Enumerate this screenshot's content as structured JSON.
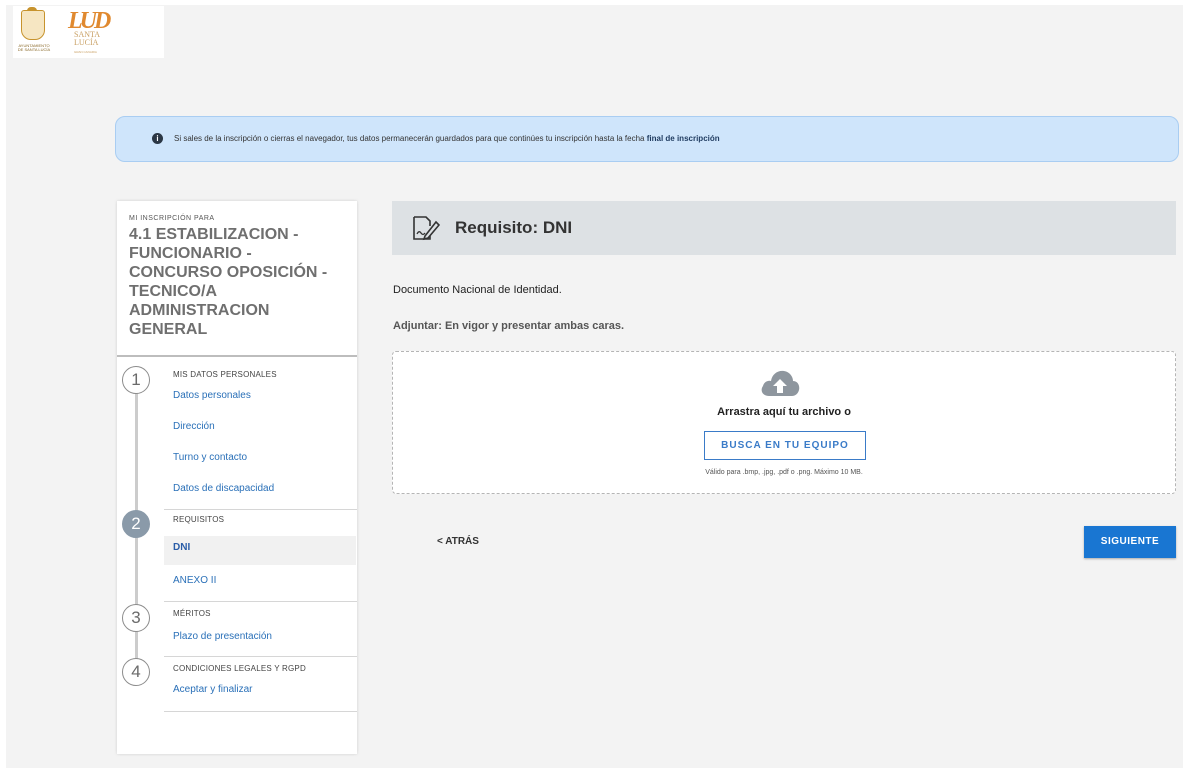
{
  "brand": {
    "crest_text": "AYUNTAMIENTO DE SANTA LUCÍA",
    "mark": "LUD",
    "name": "SANTA LUCÍA",
    "sub": "GRAN CANARIA"
  },
  "notice": {
    "icon": "info-icon",
    "text": "Si sales de la inscripción o cierras el navegador, tus datos permanecerán guardados para que continúes tu inscripción hasta la fecha ",
    "bold": "final de inscripción"
  },
  "sidebar": {
    "kicker": "MI INSCRIPCIÓN PARA",
    "title": "4.1 ESTABILIZACION - FUNCIONARIO - CONCURSO OPOSICIÓN - TECNICO/A ADMINISTRACION GENERAL",
    "steps": [
      {
        "number": "1",
        "title": "MIS DATOS PERSONALES",
        "links": [
          "Datos personales",
          "Dirección",
          "Turno y contacto",
          "Datos de discapacidad"
        ]
      },
      {
        "number": "2",
        "title": "REQUISITOS",
        "links": [
          "DNI",
          "ANEXO II"
        ],
        "current": "DNI"
      },
      {
        "number": "3",
        "title": "MÉRITOS",
        "links": [
          "Plazo de presentación"
        ]
      },
      {
        "number": "4",
        "title": "CONDICIONES LEGALES Y RGPD",
        "links": [
          "Aceptar y finalizar"
        ]
      }
    ]
  },
  "main": {
    "header_icon": "document-signature-icon",
    "title": "Requisito: DNI",
    "description": "Documento Nacional de Identidad.",
    "attach": "Adjuntar: En vigor y presentar ambas caras.",
    "dropzone": {
      "icon": "cloud-upload-icon",
      "text": "Arrastra aquí tu archivo o",
      "button": "BUSCA EN TU EQUIPO",
      "note": "Válido para .bmp, .jpg, .pdf o .png. Máximo 10 MB."
    },
    "back": "< ATRÁS",
    "next": "SIGUIENTE"
  },
  "colors": {
    "primary": "#1976d2",
    "notice_bg": "#cfe5fb",
    "link": "#2a70b8"
  }
}
